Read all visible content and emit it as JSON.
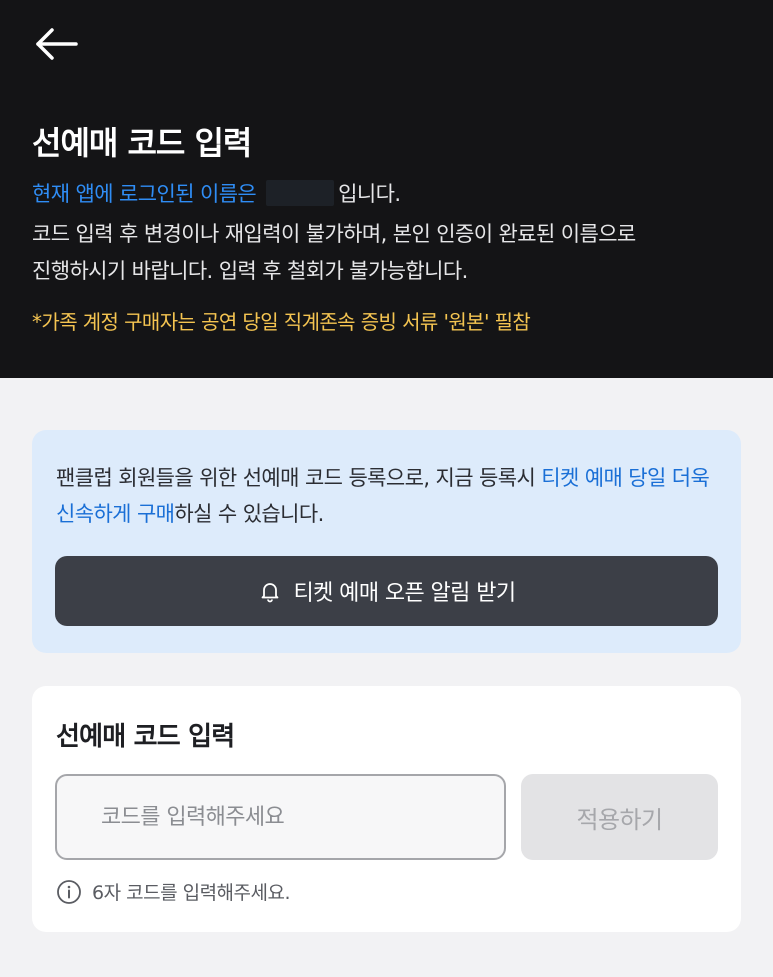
{
  "header": {
    "title": "선예매 코드 입력",
    "name_notice_prefix": "현재 앱에 로그인된 이름은",
    "name_notice_suffix": "입니다.",
    "desc_line2": "코드 입력 후 변경이나 재입력이 불가하며, 본인 인증이 완료된 이름으로",
    "desc_line3": "진행하시기 바랍니다. 입력 후 철회가 불가능합니다.",
    "family_note": "*가족 계정 구매자는 공연 당일 직계존속 증빙 서류 '원본' 필참"
  },
  "info_card": {
    "text_part1": "팬클럽 회원들을 위한 선예매 코드 등록으로, 지금 등록시 ",
    "text_highlight": "티켓 예매 당일 더욱 신속하게 구매",
    "text_part2": "하실 수 있습니다.",
    "alert_button_label": "티켓 예매 오픈 알림 받기"
  },
  "code_card": {
    "title": "선예매 코드 입력",
    "input_placeholder": "코드를 입력해주세요",
    "input_value": "",
    "apply_button_label": "적용하기",
    "hint": "6자 코드를 입력해주세요."
  },
  "colors": {
    "header_bg": "#141416",
    "highlight_blue": "#2f8df5",
    "note_yellow": "#f4c451",
    "info_bg": "#ddebfb",
    "dark_button": "#3c3f47"
  },
  "icons": {
    "back": "arrow-left-icon",
    "bell": "bell-icon",
    "info": "info-circle-icon"
  }
}
